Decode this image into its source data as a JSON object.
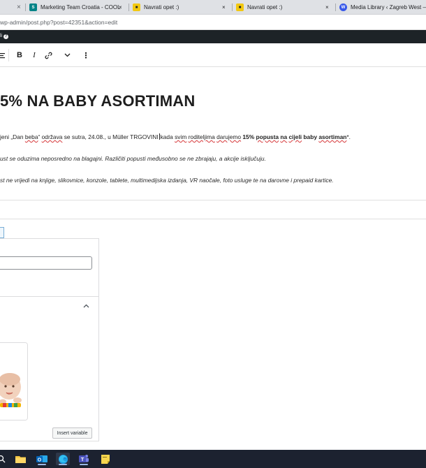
{
  "browser": {
    "tabs": [
      {
        "title": "Marketing Team Croatia - COOL",
        "icon": "sharepoint-icon",
        "color": "#038387"
      },
      {
        "title": "Navrati opet :)",
        "icon": "offer-icon",
        "color": "#f2c811"
      },
      {
        "title": "Navrati opet :)",
        "icon": "offer-icon",
        "color": "#f2c811"
      },
      {
        "title": "Media Library ‹ Zagreb West —",
        "icon": "wordpress-icon",
        "color": "#3858e9"
      }
    ],
    "close_glyph": "×",
    "url": "wp-admin/post.php?post=42351&action=edit"
  },
  "admin_bar": {
    "text": "li",
    "help": "?"
  },
  "toolbar": {
    "bold": "B",
    "italic": "I",
    "more": "⋮"
  },
  "post": {
    "title": "5% NA BABY ASORTIMAN",
    "p1": {
      "a": "jeni „",
      "b": "Dan ",
      "c": "beba",
      "d": "“ ",
      "e": "održava",
      "f": " se sutra, 24.08., u Müller TRGOVINI",
      "g": "kada ",
      "h": "svim",
      "i": " ",
      "j": "roditeljima",
      "k": " ",
      "l": "darujemo",
      "m": " 15% ",
      "n": "popusta",
      "o": " ",
      "p": "na",
      "q": " ",
      "r": "cijeli",
      "s": " baby ",
      "t": "asortiman",
      "u": "*."
    },
    "p2": "ust se oduzima neposredno na blagajni. Različiti popusti međusobno se ne zbrajaju, a akcije isključuju.",
    "p3": "st ne vrijedi na knjige, slikovnice, konzole, tablete, multimedijska izdanja, VR naočale, foto usluge te na darovne i prepaid kartice."
  },
  "panel": {
    "input_value": "",
    "insert_variable_label": "Insert variable",
    "collapse_glyph": "⌃"
  },
  "taskbar": {
    "items": [
      "search-icon",
      "file-explorer-icon",
      "outlook-icon",
      "edge-icon",
      "teams-icon",
      "sticky-notes-icon"
    ]
  }
}
